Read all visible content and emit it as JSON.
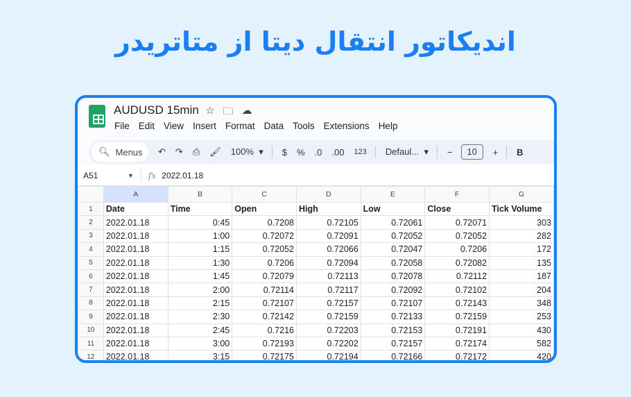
{
  "banner_title": "اندیکاتور انتقال دیتا از متاتریدر",
  "doc": {
    "title": "AUDUSD 15min",
    "icons": [
      "star-icon",
      "move-to-folder-icon",
      "cloud-saved-icon"
    ]
  },
  "menu": [
    "File",
    "Edit",
    "View",
    "Insert",
    "Format",
    "Data",
    "Tools",
    "Extensions",
    "Help"
  ],
  "toolbar": {
    "search": "Menus",
    "zoom": "100%",
    "currency": "$",
    "percent": "%",
    "dec_less": ".0",
    "dec_more": ".00",
    "format_123": "123",
    "font": "Defaul...",
    "font_size": "10",
    "minus": "−",
    "plus": "+",
    "bold": "B"
  },
  "formula_bar": {
    "cell_ref": "A51",
    "fx": "fx",
    "value": "2022.01.18"
  },
  "columns": [
    "A",
    "B",
    "C",
    "D",
    "E",
    "F",
    "G"
  ],
  "headers": [
    "Date",
    "Time",
    "Open",
    "High",
    "Low",
    "Close",
    "Tick Volume"
  ],
  "rows": [
    [
      "2022.01.18",
      "0:45",
      "0.7208",
      "0.72105",
      "0.72061",
      "0.72071",
      "303"
    ],
    [
      "2022.01.18",
      "1:00",
      "0.72072",
      "0.72091",
      "0.72052",
      "0.72052",
      "282"
    ],
    [
      "2022.01.18",
      "1:15",
      "0.72052",
      "0.72066",
      "0.72047",
      "0.7206",
      "172"
    ],
    [
      "2022.01.18",
      "1:30",
      "0.7206",
      "0.72094",
      "0.72058",
      "0.72082",
      "135"
    ],
    [
      "2022.01.18",
      "1:45",
      "0.72079",
      "0.72113",
      "0.72078",
      "0.72112",
      "187"
    ],
    [
      "2022.01.18",
      "2:00",
      "0.72114",
      "0.72117",
      "0.72092",
      "0.72102",
      "204"
    ],
    [
      "2022.01.18",
      "2:15",
      "0.72107",
      "0.72157",
      "0.72107",
      "0.72143",
      "348"
    ],
    [
      "2022.01.18",
      "2:30",
      "0.72142",
      "0.72159",
      "0.72133",
      "0.72159",
      "253"
    ],
    [
      "2022.01.18",
      "2:45",
      "0.7216",
      "0.72203",
      "0.72153",
      "0.72191",
      "430"
    ],
    [
      "2022.01.18",
      "3:00",
      "0.72193",
      "0.72202",
      "0.72157",
      "0.72174",
      "582"
    ],
    [
      "2022.01.18",
      "3:15",
      "0.72175",
      "0.72194",
      "0.72166",
      "0.72172",
      "420"
    ]
  ]
}
